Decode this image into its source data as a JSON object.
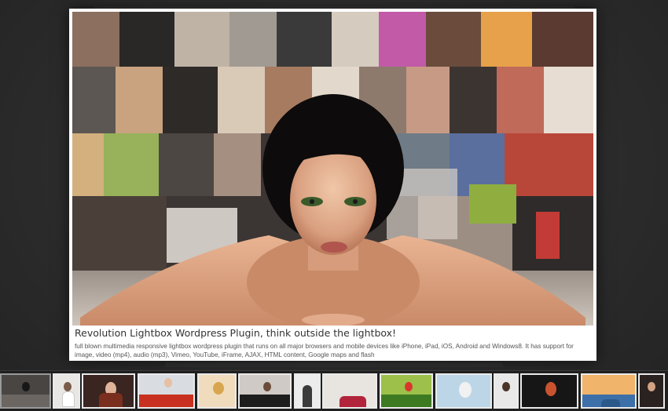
{
  "lightbox": {
    "title": "Revolution Lightbox Wordpress Plugin, think outside the lightbox!",
    "description": "full blown multimedia responsive lightbox wordpress plugin that runs on all major browsers and mobile devices like iPhone, iPad, iOS, Android and Windows8. It has support for image, video (mp4), audio (mp3), Vimeo, YouTube, iFrame, AJAX, HTML content, Google maps and flash"
  },
  "colors": {
    "overlay": "#2e2e2e",
    "frame": "#ffffff",
    "title_text": "#333333",
    "desc_text": "#555555"
  },
  "thumbnails": [
    {
      "subject": "woman-lying",
      "active": true
    },
    {
      "subject": "woman-white-dress"
    },
    {
      "subject": "woman-red-hair"
    },
    {
      "subject": "woman-flower-field"
    },
    {
      "subject": "blonde-woman"
    },
    {
      "subject": "woman-sofa"
    },
    {
      "subject": "woman-standing"
    },
    {
      "subject": "woman-lying-pink"
    },
    {
      "subject": "woman-green-field"
    },
    {
      "subject": "woman-blue-face"
    },
    {
      "subject": "woman-portrait"
    },
    {
      "subject": "woman-face-paint"
    },
    {
      "subject": "boat-at-sea"
    },
    {
      "subject": "woman-dark-hair"
    }
  ]
}
